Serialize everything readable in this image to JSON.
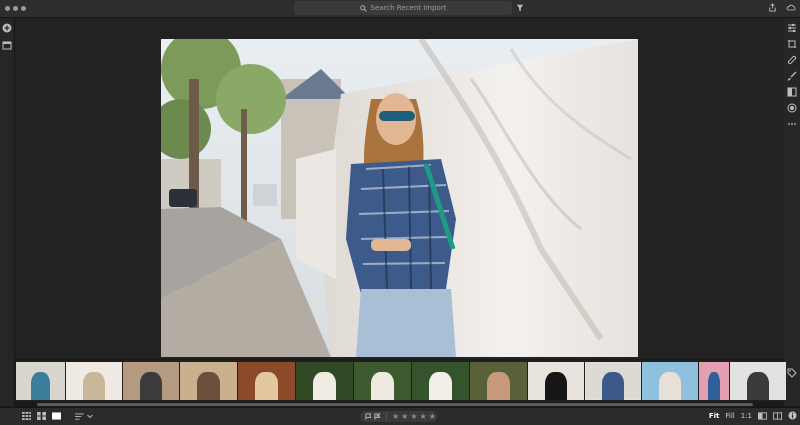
{
  "topbar": {
    "search_placeholder": "Search Recent Import",
    "icons": [
      "search-icon",
      "filter-icon",
      "share-icon",
      "cloud-sync-icon"
    ]
  },
  "left_panel": {
    "icons": [
      "add-icon",
      "library-icon"
    ]
  },
  "right_panel": {
    "icons": [
      "edit-sliders-icon",
      "crop-rotate-icon",
      "healing-icon",
      "brush-icon",
      "linear-gradient-icon",
      "radial-gradient-icon",
      "more-icon"
    ],
    "bottom_icons": [
      "keywords-tag-icon",
      "info-icon"
    ]
  },
  "filmstrip": {
    "thumbnails": [
      {
        "desc": "woman with laptop",
        "colors": [
          "#d9d6cf",
          "#3a7f9a"
        ]
      },
      {
        "desc": "interior plant decor",
        "colors": [
          "#efeae3",
          "#c9b79a"
        ]
      },
      {
        "desc": "woman on street with sunglasses",
        "colors": [
          "#b49a80",
          "#3b3b3b"
        ]
      },
      {
        "desc": "woman with hat",
        "colors": [
          "#c9b08f",
          "#6b4f3a"
        ]
      },
      {
        "desc": "woman in autumn leaves",
        "colors": [
          "#8b4a2a",
          "#e2c7a0"
        ]
      },
      {
        "desc": "woman with flowers",
        "colors": [
          "#2f4a25",
          "#f0ece4"
        ]
      },
      {
        "desc": "woman in white blossoms",
        "colors": [
          "#3c5a2e",
          "#eeeae2"
        ]
      },
      {
        "desc": "woman among white roses",
        "colors": [
          "#35542c",
          "#f2efe8"
        ]
      },
      {
        "desc": "woman outdoor portrait",
        "colors": [
          "#58613a",
          "#c69a7a"
        ]
      },
      {
        "desc": "woman in black dress",
        "colors": [
          "#e7e3dc",
          "#151515"
        ]
      },
      {
        "desc": "woman in plaid shirt (selected)",
        "colors": [
          "#ddd9d3",
          "#3b5a8a"
        ]
      },
      {
        "desc": "woman on beach with camera",
        "colors": [
          "#8fc0dd",
          "#e6e0d6"
        ]
      },
      {
        "desc": "woman on pink background",
        "colors": [
          "#e59fb2",
          "#2f5f9a"
        ]
      },
      {
        "desc": "woman portrait grey",
        "colors": [
          "#e3e2e0",
          "#3a3a3a"
        ]
      }
    ]
  },
  "bottombar": {
    "view_icons": [
      "grid-view-icon",
      "square-grid-icon",
      "detail-view-icon"
    ],
    "sort_icon": "sort-icon",
    "flags": [
      "pick-flag-icon",
      "reject-flag-icon"
    ],
    "rating": 0,
    "stars": [
      "★",
      "★",
      "★",
      "★",
      "★"
    ],
    "zoom": {
      "fit": "Fit",
      "fill": "Fill",
      "one_to_one": "1:1"
    },
    "right_icons": [
      "compare-icon",
      "split-view-icon"
    ]
  },
  "colors": {
    "accent": "#ffffff",
    "panel": "#262626",
    "canvas": "#222222"
  }
}
